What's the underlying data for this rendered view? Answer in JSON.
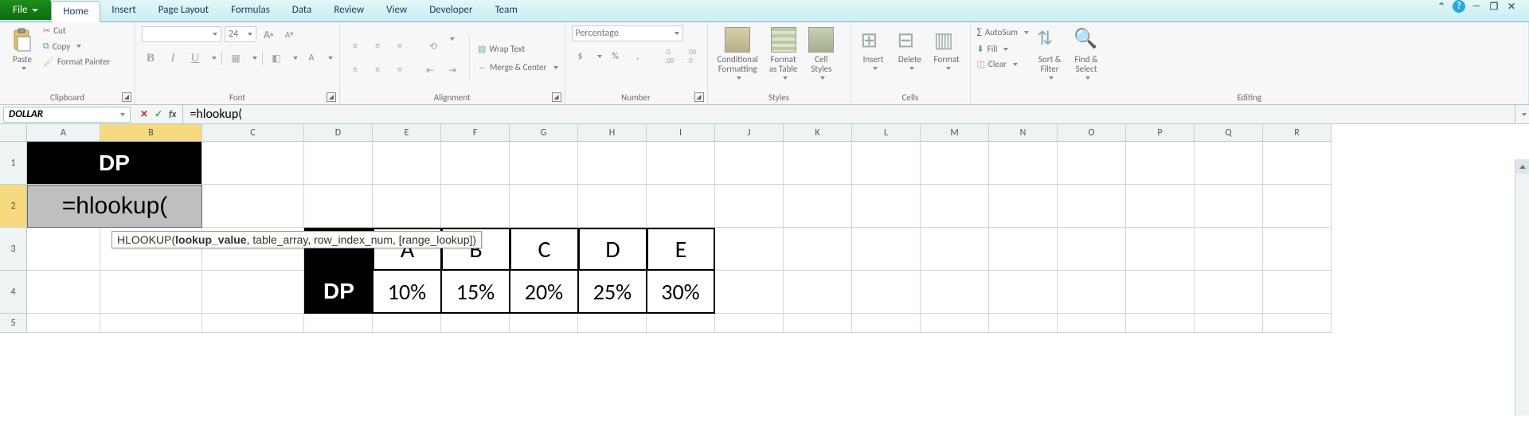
{
  "tabs": {
    "file": "File",
    "items": [
      "Home",
      "Insert",
      "Page Layout",
      "Formulas",
      "Data",
      "Review",
      "View",
      "Developer",
      "Team"
    ],
    "active": "Home"
  },
  "ribbon": {
    "clipboard": {
      "label": "Clipboard",
      "paste": "Paste",
      "cut": "Cut",
      "copy": "Copy",
      "format_painter": "Format Painter"
    },
    "font": {
      "label": "Font",
      "family": "",
      "size": "24"
    },
    "alignment": {
      "label": "Alignment",
      "wrap": "Wrap Text",
      "merge": "Merge & Center"
    },
    "number": {
      "label": "Number",
      "format": "Percentage",
      "currency": "$",
      "percent": "%",
      "comma": ",",
      "inc": "Increase Decimal",
      "dec": "Decrease Decimal"
    },
    "styles": {
      "label": "Styles",
      "cond": "Conditional\nFormatting",
      "table": "Format\nas Table",
      "cell": "Cell\nStyles"
    },
    "cells": {
      "label": "Cells",
      "insert": "Insert",
      "delete": "Delete",
      "format": "Format"
    },
    "editing": {
      "label": "Editing",
      "autosum": "AutoSum",
      "fill": "Fill",
      "clear": "Clear",
      "sort": "Sort &\nFilter",
      "find": "Find &\nSelect"
    }
  },
  "formula_bar": {
    "namebox": "DOLLAR",
    "formula": "=hlookup("
  },
  "tooltip": {
    "func": "HLOOKUP(",
    "arg_active": "lookup_value",
    "rest": ", table_array, row_index_num, [range_lookup])"
  },
  "columns": [
    "A",
    "B",
    "C",
    "D",
    "E",
    "F",
    "G",
    "H",
    "I",
    "J",
    "K",
    "L",
    "M",
    "N",
    "O",
    "P",
    "Q",
    "R"
  ],
  "rows": [
    "1",
    "2",
    "3",
    "4",
    "5"
  ],
  "active_row": "2",
  "data": {
    "a1b1": "DP",
    "a2b2": "=hlookup(",
    "d3": "",
    "e3": "A",
    "f3": "B",
    "g3": "C",
    "h3": "D",
    "i3": "E",
    "d4": "DP",
    "e4": "10%",
    "f4": "15%",
    "g4": "20%",
    "h4": "25%",
    "i4": "30%"
  }
}
